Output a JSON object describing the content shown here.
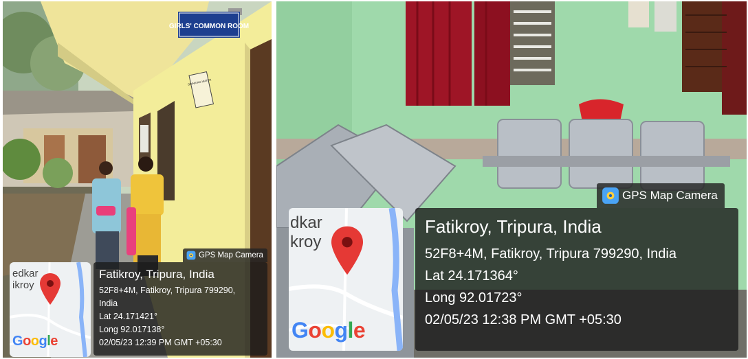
{
  "left_photo": {
    "sign_common_room": "GIRLS' COMMON ROOM",
    "sign_small": "DRINKING WATER",
    "gps": {
      "brand": "GPS Map Camera",
      "title": "Fatikroy, Tripura, India",
      "address_line1": "52F8+4M, Fatikroy, Tripura 799290,",
      "address_line2": "India",
      "lat": "Lat 24.171421°",
      "long": "Long 92.017138°",
      "datetime": "02/05/23 12:39 PM GMT +05:30",
      "map_label_line1": "edkar",
      "map_label_line2": "ikroy"
    }
  },
  "right_photo": {
    "gps": {
      "brand": "GPS Map Camera",
      "title": "Fatikroy, Tripura, India",
      "address": "52F8+4M, Fatikroy, Tripura 799290, India",
      "lat": "Lat 24.171364°",
      "long": "Long 92.01723°",
      "datetime": "02/05/23 12:38 PM GMT +05:30",
      "map_label_line1": "dkar",
      "map_label_line2": "kroy"
    }
  },
  "google_logo": {
    "g1": "G",
    "o1": "o",
    "o2": "o",
    "g2": "g",
    "l": "l",
    "e": "e"
  },
  "colors": {
    "wall_green": "#9fd9ab",
    "building_yellow": "#f3ed9a",
    "curtain_red": "#9e1526",
    "pin_red": "#e53935",
    "sign_blue": "#1d3f8f"
  }
}
